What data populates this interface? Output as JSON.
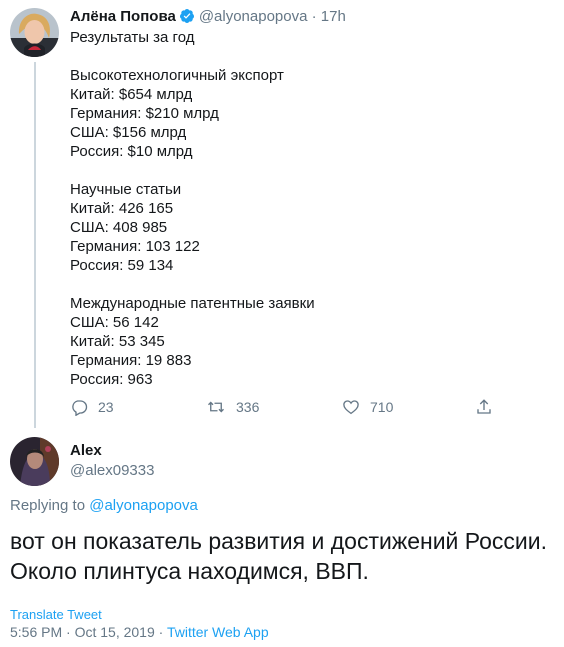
{
  "parent_tweet": {
    "author_name": "Алёна Попова",
    "handle": "@alyonapopova",
    "separator": "·",
    "time": "17h",
    "lines": [
      "Результаты за год",
      "",
      "Высокотехнологичный экспорт",
      "Китай: $654 млрд",
      "Германия: $210 млрд",
      "США: $156 млрд",
      "Россия: $10 млрд",
      "",
      "Научные статьи",
      "Китай: 426 165",
      "США: 408 985",
      "Германия: 103 122",
      "Россия: 59 134",
      "",
      "Международные патентные заявки",
      "США: 56 142",
      "Китай: 53 345",
      "Германия: 19 883",
      "Россия: 963"
    ],
    "actions": {
      "replies": "23",
      "retweets": "336",
      "likes": "710"
    }
  },
  "reply_tweet": {
    "author_name": "Alex",
    "handle": "@alex09333",
    "replying_prefix": "Replying to",
    "replying_to": "@alyonapopova",
    "text_line1": "вот он показатель развития и достижений России.",
    "text_line2": "Около плинтуса находимся, ВВП.",
    "translate_label": "Translate Tweet",
    "timestamp": "5:56 PM · Oct 15, 2019 ·",
    "app": "Twitter Web App"
  },
  "colors": {
    "accent": "#1da1f2",
    "secondary_text": "#657786",
    "primary_text": "#14171a",
    "thread_line": "#ccd6dd"
  }
}
